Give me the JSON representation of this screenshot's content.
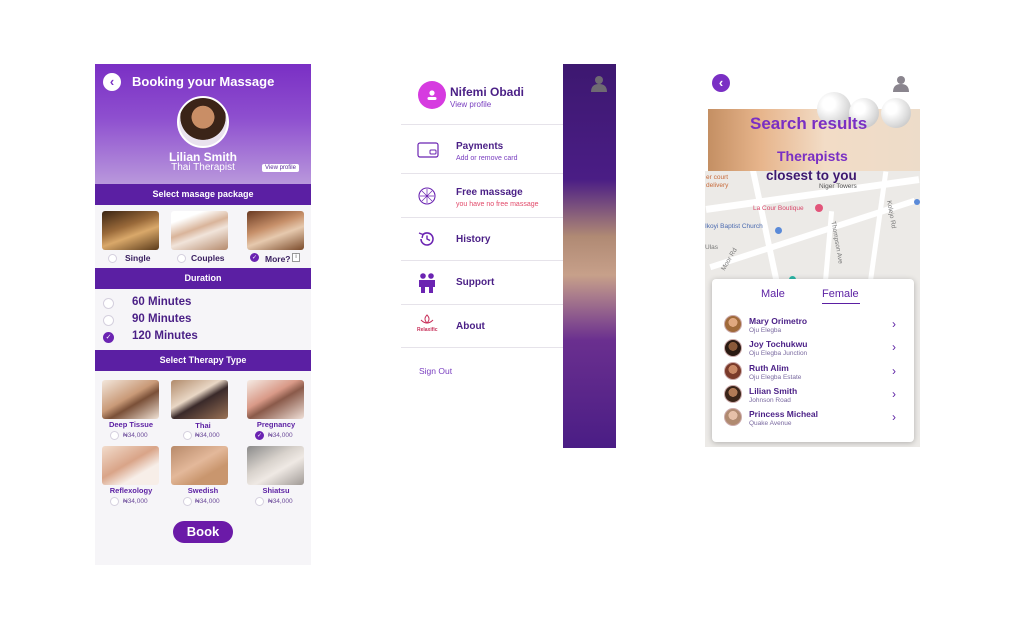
{
  "booking": {
    "title": "Booking your Massage",
    "therapist_name": "Lilian Smith",
    "therapist_role": "Thai Therapist",
    "view_profile": "View profile",
    "package_header": "Select masage package",
    "packages": [
      {
        "label": "Single",
        "selected": false
      },
      {
        "label": "Couples",
        "selected": false
      },
      {
        "label": "More?",
        "selected": true
      }
    ],
    "more_box": "i",
    "duration_header": "Duration",
    "durations": [
      {
        "label": "60 Minutes",
        "selected": false
      },
      {
        "label": "90 Minutes",
        "selected": false
      },
      {
        "label": "120 Minutes",
        "selected": true
      }
    ],
    "therapy_header": "Select Therapy Type",
    "therapies": [
      {
        "name": "Deep Tissue",
        "price": "₦34,000",
        "selected": false
      },
      {
        "name": "Thai",
        "price": "₦34,000",
        "selected": false
      },
      {
        "name": "Pregnancy",
        "price": "₦34,000",
        "selected": true
      },
      {
        "name": "Reflexology",
        "price": "₦34,000",
        "selected": false
      },
      {
        "name": "Swedish",
        "price": "₦34,000",
        "selected": false
      },
      {
        "name": "Shiatsu",
        "price": "₦34,000",
        "selected": false
      }
    ],
    "book_label": "Book"
  },
  "menu": {
    "user_name": "Nifemi Obadi",
    "view_profile": "View profile",
    "items": [
      {
        "label": "Payments",
        "sub": "Add or remove card",
        "icon": "card-icon"
      },
      {
        "label": "Free massage",
        "sub": "you have no free massage",
        "icon": "compass-icon"
      },
      {
        "label": "History",
        "sub": "",
        "icon": "history-icon"
      },
      {
        "label": "Support",
        "sub": "",
        "icon": "people-icon"
      },
      {
        "label": "About",
        "sub": "",
        "icon": "logo-icon"
      }
    ],
    "about_logo_text": "Relaxific",
    "sign_out": "Sign Out"
  },
  "search": {
    "title": "Search results",
    "subtitle1": "Therapists",
    "subtitle2": "closest to you",
    "map_labels": [
      "er court",
      "delivery",
      "Niger Towers",
      "La Cour Boutique",
      "Ikoyi Baptist Church",
      "Mosque",
      "Moor Rd",
      "Ulas",
      "Thompson Ave",
      "Kolejo Rd"
    ],
    "tabs": {
      "male": "Male",
      "female": "Female",
      "active": "Female"
    },
    "therapists": [
      {
        "name": "Mary Orimetro",
        "location": "Oju Elegba"
      },
      {
        "name": "Joy Tochukwu",
        "location": "Oju Elegba Junction"
      },
      {
        "name": "Ruth Alim",
        "location": "Oju Elegba Estate"
      },
      {
        "name": "Lilian Smith",
        "location": "Johnson Road"
      },
      {
        "name": "Princess Micheal",
        "location": "Quake Avenue"
      }
    ]
  },
  "colors": {
    "brand": "#6b24b2",
    "dark": "#5b1fa3",
    "accent_pink": "#d63be0",
    "free_note": "#e24a6a"
  }
}
